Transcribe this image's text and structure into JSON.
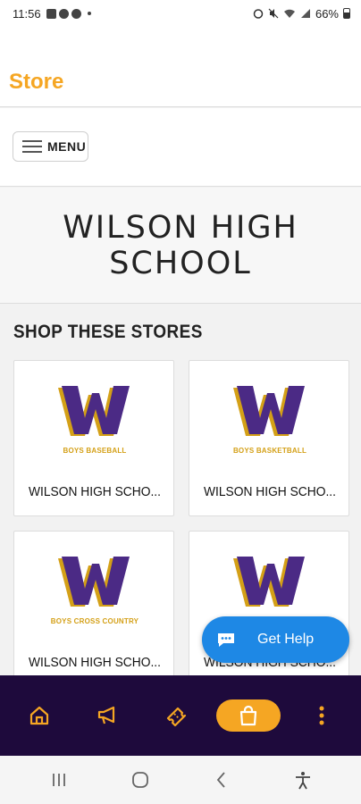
{
  "status_bar": {
    "time": "11:56",
    "battery": "66%"
  },
  "header": {
    "title": "Store"
  },
  "menu": {
    "label": "MENU"
  },
  "school": {
    "name": "WILSON HIGH SCHOOL"
  },
  "shop": {
    "heading": "SHOP THESE STORES",
    "stores": [
      {
        "title": "WILSON HIGH SCHO...",
        "subtitle": "BOYS BASEBALL",
        "logo_letter": "W"
      },
      {
        "title": "WILSON HIGH SCHO...",
        "subtitle": "BOYS BASKETBALL",
        "logo_letter": "W"
      },
      {
        "title": "WILSON HIGH SCHO...",
        "subtitle": "BOYS CROSS COUNTRY",
        "logo_letter": "W"
      },
      {
        "title": "WILSON HIGH SCHO...",
        "subtitle": "",
        "logo_letter": "W"
      }
    ]
  },
  "help": {
    "label": "Get Help"
  },
  "bottom_nav": {
    "items": [
      {
        "icon": "home-icon"
      },
      {
        "icon": "megaphone-icon"
      },
      {
        "icon": "ticket-icon"
      },
      {
        "icon": "shopping-bag-icon",
        "active": true
      },
      {
        "icon": "more-vertical-icon"
      }
    ]
  },
  "colors": {
    "accent": "#f5a623",
    "nav_bg": "#1e0a3c",
    "logo_purple": "#4b2a85",
    "logo_gold": "#d4a017",
    "help_blue": "#1e88e5"
  }
}
